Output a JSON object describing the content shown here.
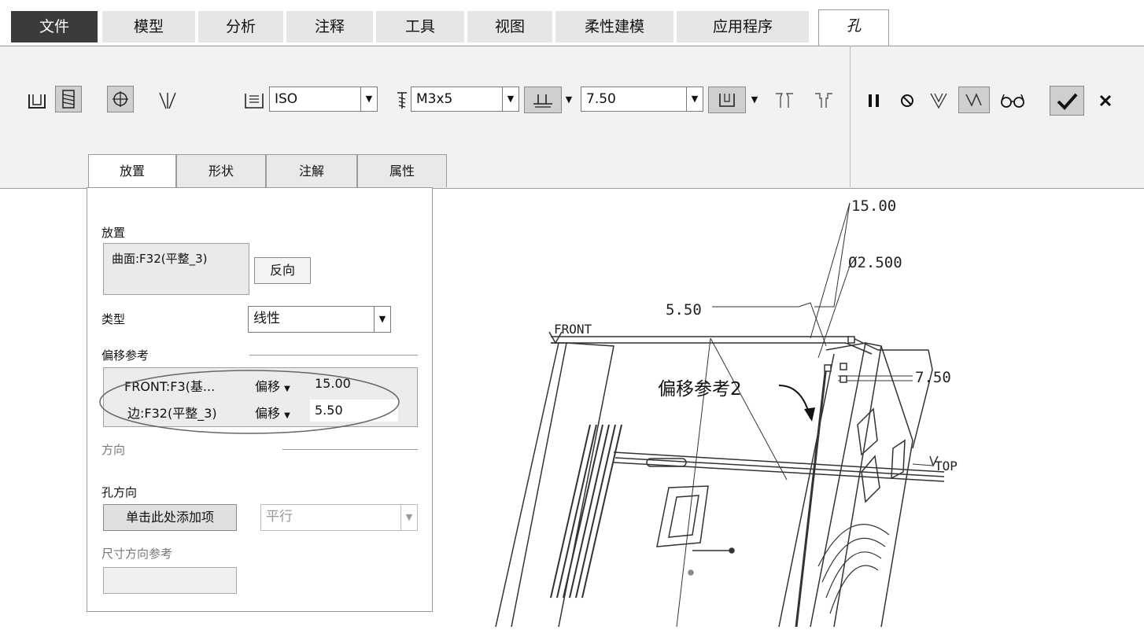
{
  "menu": {
    "tabs": [
      {
        "label": "文件"
      },
      {
        "label": "模型"
      },
      {
        "label": "分析"
      },
      {
        "label": "注释"
      },
      {
        "label": "工具"
      },
      {
        "label": "视图"
      },
      {
        "label": "柔性建模"
      },
      {
        "label": "应用程序"
      },
      {
        "label": "孔"
      }
    ]
  },
  "ribbon": {
    "standard": "ISO",
    "screw_size": "M3x5",
    "depth_value": "7.50"
  },
  "subtabs": [
    {
      "label": "放置"
    },
    {
      "label": "形状"
    },
    {
      "label": "注解"
    },
    {
      "label": "属性"
    }
  ],
  "panel": {
    "placement_label": "放置",
    "placement_value": "曲面:F32(平整_3)",
    "flip_button": "反向",
    "type_label": "类型",
    "type_value": "线性",
    "offset_refs_label": "偏移参考",
    "offset_refs": [
      {
        "ref": "FRONT:F3(基...",
        "mode": "偏移",
        "value": "15.00"
      },
      {
        "ref": "边:F32(平整_3)",
        "mode": "偏移",
        "value": "5.50"
      }
    ],
    "direction_label": "方向",
    "hole_direction_label": "孔方向",
    "add_item_button": "单击此处添加项",
    "parallel_value": "平行",
    "dim_direction_label": "尺寸方向参考"
  },
  "viewport": {
    "dim_top": "15.00",
    "dim_diameter": "Ø2.500",
    "dim_left": "5.50",
    "dim_right": "7.50",
    "label_front": "FRONT",
    "label_top": "TOP",
    "annotation": "偏移参考2"
  }
}
